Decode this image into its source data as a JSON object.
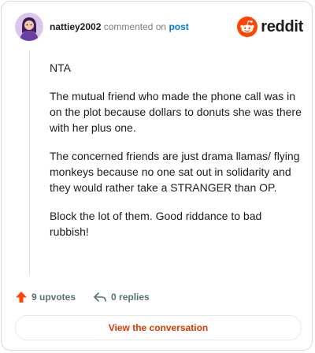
{
  "comment": {
    "username": "nattiey2002",
    "action_text": "commented on",
    "post_link": "post",
    "paragraphs": [
      "NTA",
      "The mutual friend who made the phone call was in on the plot because dollars to donuts she was there with her plus one.",
      "The concerned friends are just drama llamas/ flying monkeys because no one sat out in solidarity and they would rather take a STRANGER than OP.",
      "Block the lot of them. Good riddance to bad rubbish!"
    ],
    "upvotes": "9 upvotes",
    "replies": "0 replies"
  },
  "brand": {
    "name": "reddit",
    "icon": "reddit-logo-icon"
  },
  "cta": {
    "label": "View the conversation"
  },
  "colors": {
    "brand_orange": "#ff4500",
    "link_blue": "#0079d3",
    "cta_text": "#d93a00",
    "meta_gray": "#576f76"
  }
}
